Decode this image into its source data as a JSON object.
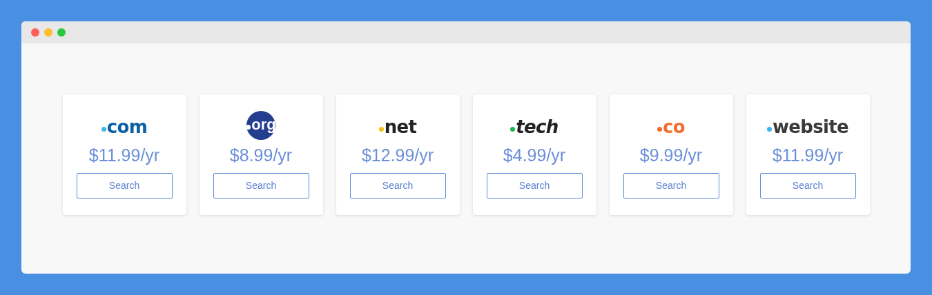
{
  "cards": [
    {
      "logo": {
        "text": "com",
        "kind": "plain",
        "color": "#0b5fa5",
        "dot": {
          "color": "#3fb6ec"
        }
      },
      "price": "$11.99/yr",
      "button": "Search"
    },
    {
      "logo": {
        "text": "org",
        "kind": "circle",
        "color": "#233d8f",
        "dot": {
          "color": "#ffffff"
        }
      },
      "price": "$8.99/yr",
      "button": "Search"
    },
    {
      "logo": {
        "text": "net",
        "kind": "plain",
        "color": "#222222",
        "dot": {
          "color": "#f2c31b"
        }
      },
      "price": "$12.99/yr",
      "button": "Search"
    },
    {
      "logo": {
        "text": "tech",
        "kind": "italic",
        "color": "#222222",
        "dot": {
          "color": "#1db64a"
        }
      },
      "price": "$4.99/yr",
      "button": "Search"
    },
    {
      "logo": {
        "text": "co",
        "kind": "plain",
        "color": "#ef6e2d",
        "dot": {
          "color": "#ef6e2d"
        }
      },
      "price": "$9.99/yr",
      "button": "Search"
    },
    {
      "logo": {
        "text": "website",
        "kind": "plain",
        "color": "#3a3a3a",
        "dot": {
          "color": "#3ab4ec"
        }
      },
      "price": "$11.99/yr",
      "button": "Search"
    }
  ]
}
